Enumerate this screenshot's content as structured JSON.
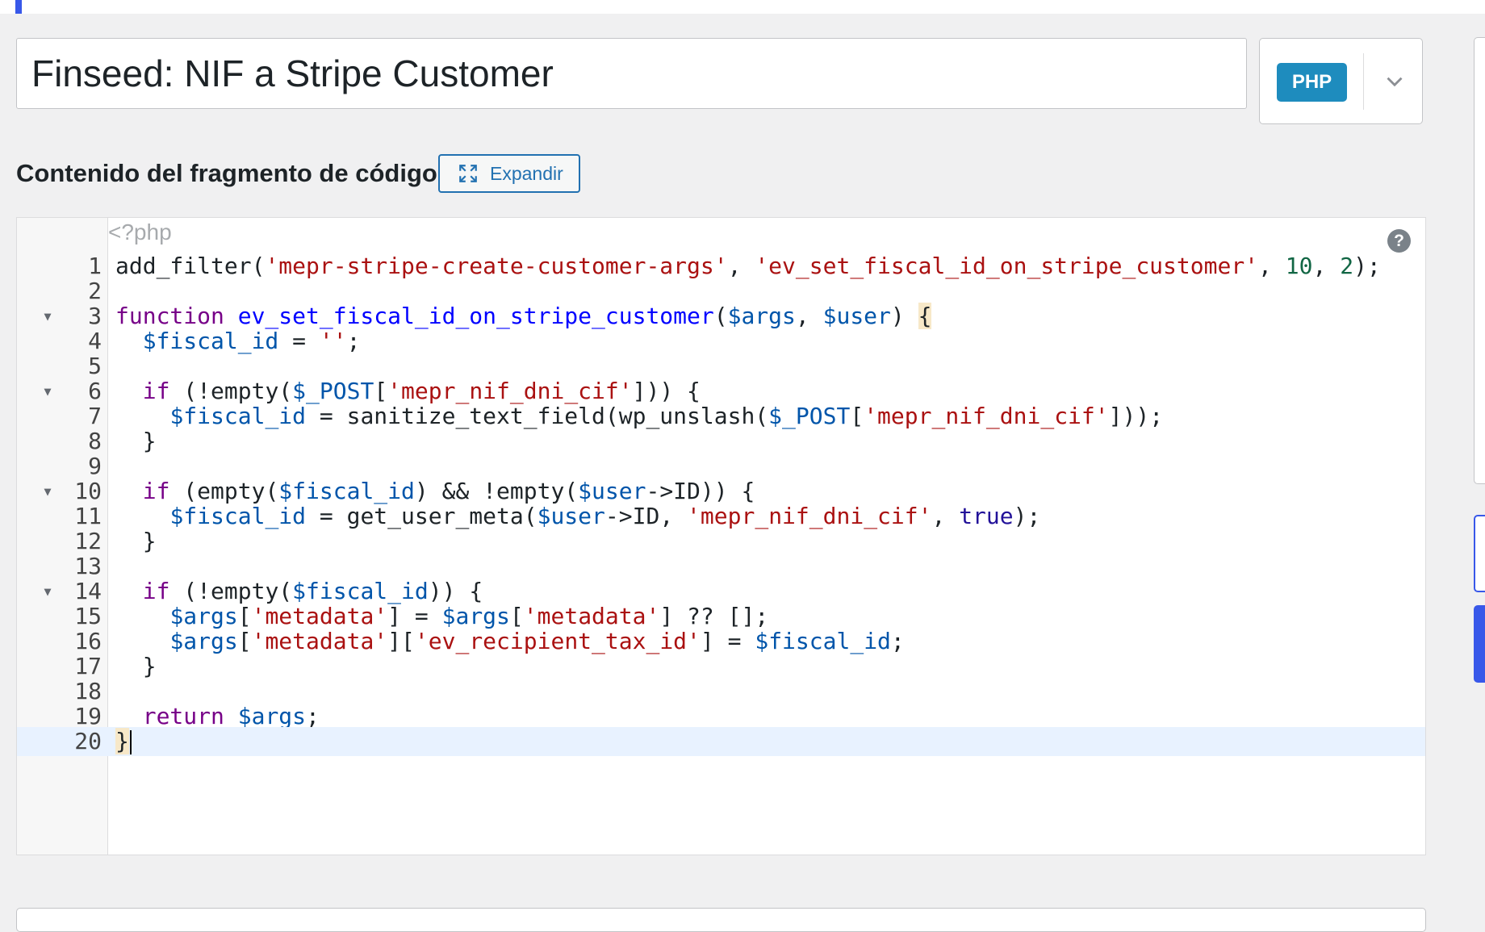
{
  "snippet": {
    "title_value": "Finseed: NIF a Stripe Customer",
    "language_badge": "PHP"
  },
  "code_section": {
    "label": "Contenido del fragmento de código",
    "expand_label": "Expandir",
    "open_tag": "<?php",
    "help_glyph": "?"
  },
  "code_lines": [
    {
      "number": "1",
      "text": "add_filter('mepr-stripe-create-customer-args', 'ev_set_fiscal_id_on_stripe_customer', 10, 2);"
    },
    {
      "number": "2",
      "text": ""
    },
    {
      "number": "3",
      "text": "function ev_set_fiscal_id_on_stripe_customer($args, $user) {",
      "fold": "▼"
    },
    {
      "number": "4",
      "text": "  $fiscal_id = '';"
    },
    {
      "number": "5",
      "text": ""
    },
    {
      "number": "6",
      "text": "  if (!empty($_POST['mepr_nif_dni_cif'])) {",
      "fold": "▼"
    },
    {
      "number": "7",
      "text": "    $fiscal_id = sanitize_text_field(wp_unslash($_POST['mepr_nif_dni_cif']));"
    },
    {
      "number": "8",
      "text": "  }"
    },
    {
      "number": "9",
      "text": ""
    },
    {
      "number": "10",
      "text": "  if (empty($fiscal_id) && !empty($user->ID)) {",
      "fold": "▼"
    },
    {
      "number": "11",
      "text": "    $fiscal_id = get_user_meta($user->ID, 'mepr_nif_dni_cif', true);"
    },
    {
      "number": "12",
      "text": "  }"
    },
    {
      "number": "13",
      "text": ""
    },
    {
      "number": "14",
      "text": "  if (!empty($fiscal_id)) {",
      "fold": "▼"
    },
    {
      "number": "15",
      "text": "    $args['metadata'] = $args['metadata'] ?? [];"
    },
    {
      "number": "16",
      "text": "    $args['metadata']['ev_recipient_tax_id'] = $fiscal_id;"
    },
    {
      "number": "17",
      "text": "  }"
    },
    {
      "number": "18",
      "text": ""
    },
    {
      "number": "19",
      "text": "  return $args;"
    },
    {
      "number": "20",
      "text": "}",
      "active": true
    }
  ],
  "icons": {
    "language_dropdown": "chevron-down-icon",
    "expand": "expand-icon",
    "help": "help-icon",
    "fold": "fold-arrow-icon"
  },
  "colors": {
    "accent": "#3858e9",
    "php_badge": "#1e8cbe",
    "button_border": "#2271b1",
    "keyword": "#770088",
    "definition": "#0000ff",
    "variable": "#0055aa",
    "string": "#aa1111",
    "number": "#116644",
    "atom": "#221199",
    "active_line": "#e8f2ff"
  }
}
